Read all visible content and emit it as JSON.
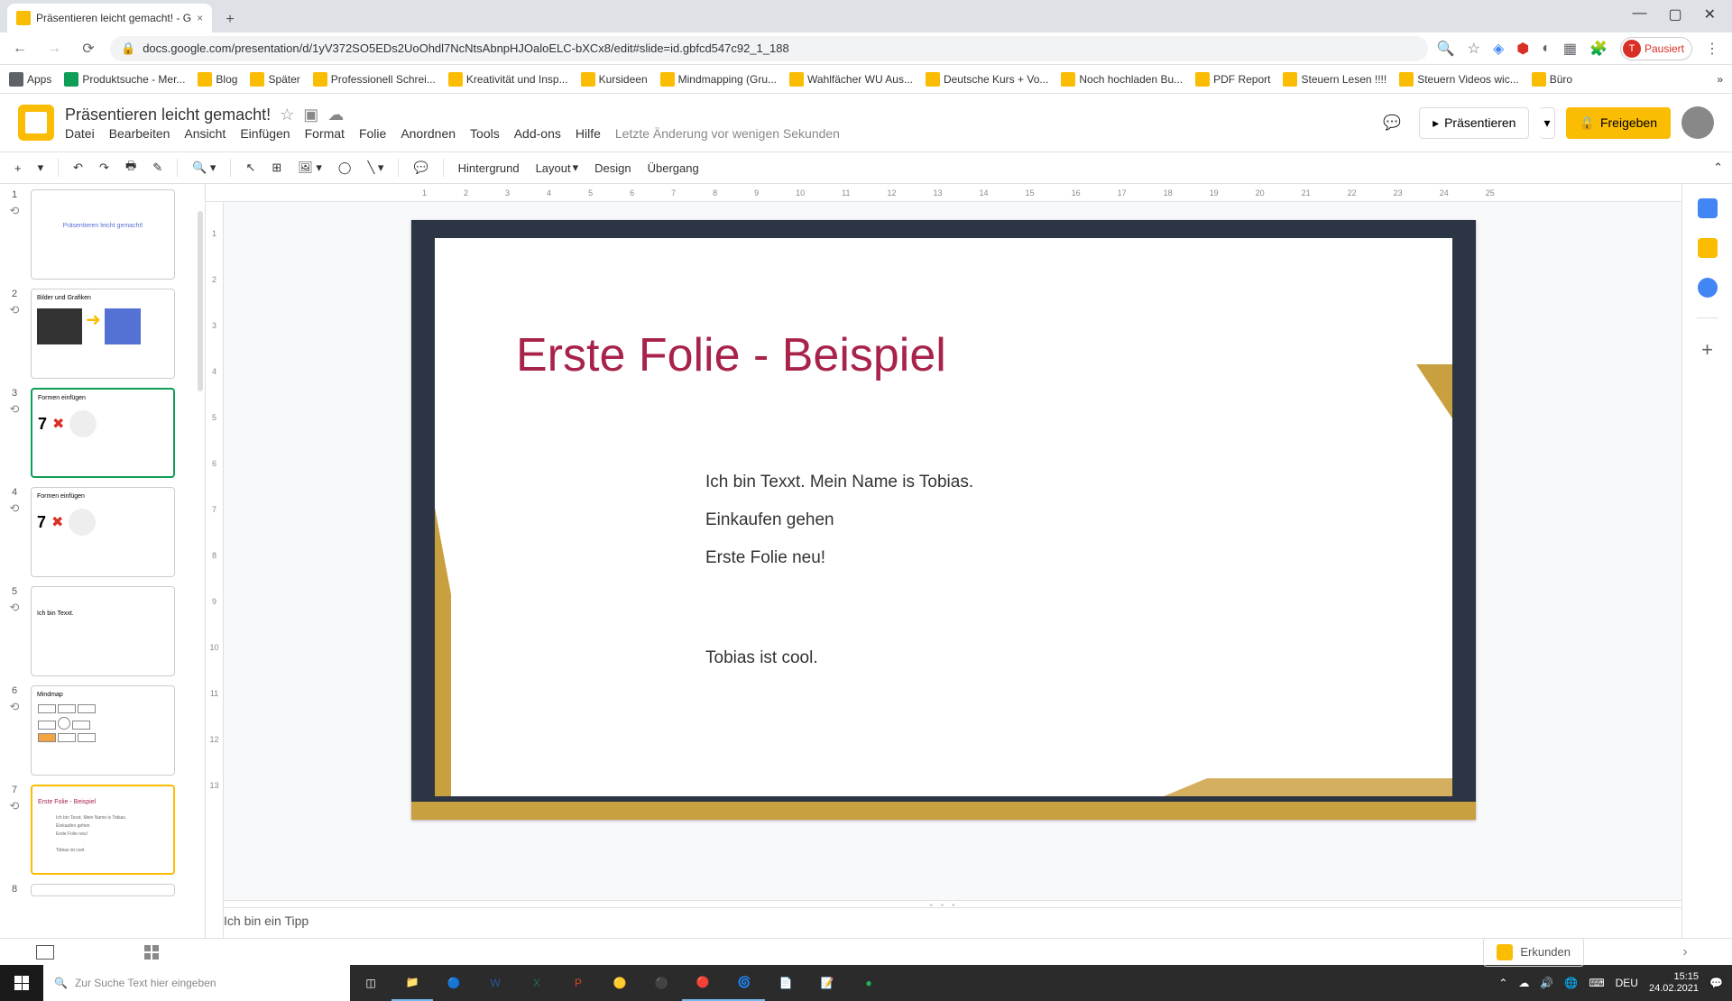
{
  "browser": {
    "tab_title": "Präsentieren leicht gemacht! - G",
    "url": "docs.google.com/presentation/d/1yV372SO5EDs2UoOhdl7NcNtsAbnpHJOaloELC-bXCx8/edit#slide=id.gbfcd547c92_1_188",
    "pausiert": "Pausiert"
  },
  "bookmarks": [
    "Apps",
    "Produktsuche - Mer...",
    "Blog",
    "Später",
    "Professionell Schrei...",
    "Kreativität und Insp...",
    "Kursideen",
    "Mindmapping (Gru...",
    "Wahlfächer WU Aus...",
    "Deutsche Kurs + Vo...",
    "Noch hochladen Bu...",
    "PDF Report",
    "Steuern Lesen !!!!",
    "Steuern Videos wic...",
    "Büro"
  ],
  "app": {
    "doc_title": "Präsentieren leicht gemacht!",
    "menus": [
      "Datei",
      "Bearbeiten",
      "Ansicht",
      "Einfügen",
      "Format",
      "Folie",
      "Anordnen",
      "Tools",
      "Add-ons",
      "Hilfe"
    ],
    "last_edit": "Letzte Änderung vor wenigen Sekunden",
    "present": "Präsentieren",
    "share": "Freigeben"
  },
  "toolbar": {
    "background": "Hintergrund",
    "layout": "Layout",
    "design": "Design",
    "transition": "Übergang"
  },
  "slide": {
    "title": "Erste Folie - Beispiel",
    "line1": "Ich bin Texxt. Mein Name is Tobias.",
    "line2": "Einkaufen gehen",
    "line3": "Erste Folie neu!",
    "line4": "Tobias ist cool."
  },
  "notes": "Ich bin ein Tipp",
  "explore": "Erkunden",
  "thumbs": {
    "t1": "Präsentieren leicht gemacht!",
    "t2": "Bilder und Grafiken",
    "t3": "Formen einfügen",
    "t4": "Formen einfügen",
    "t5": "Ich bin Texxt.",
    "t6": "Mindmap",
    "t7": "Erste Folie - Beispiel"
  },
  "taskbar": {
    "search": "Zur Suche Text hier eingeben",
    "time": "15:15",
    "date": "24.02.2021",
    "lang": "DEU"
  }
}
